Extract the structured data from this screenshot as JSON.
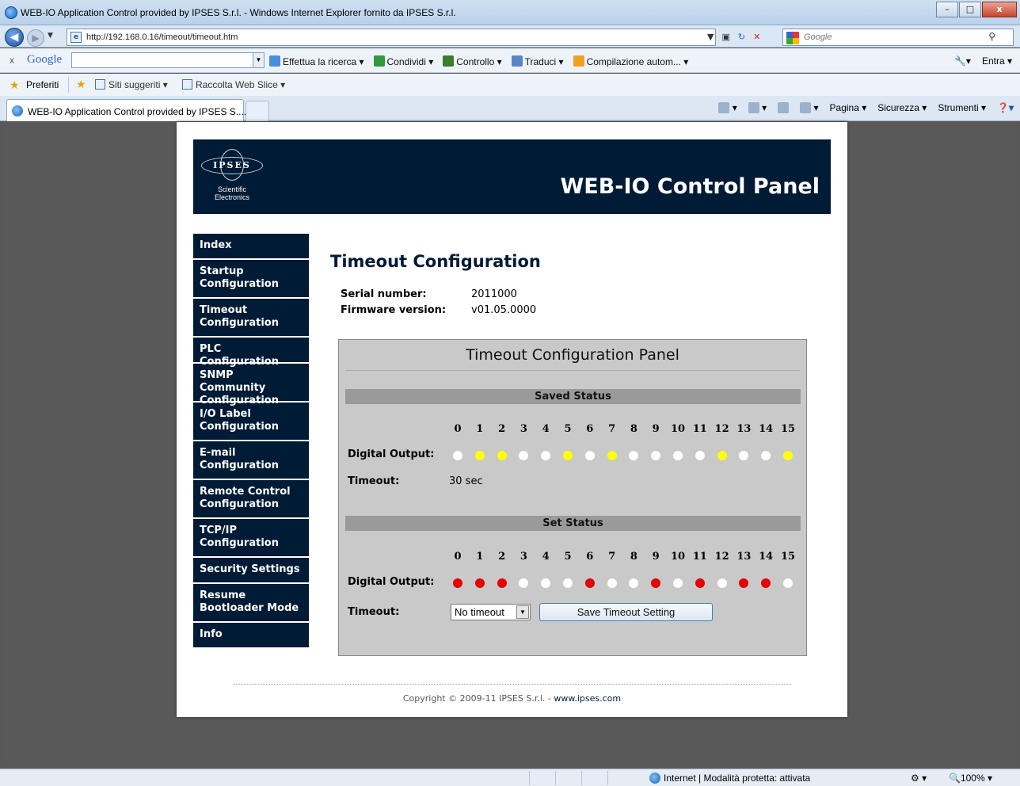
{
  "window": {
    "title": "WEB-IO Application Control provided by IPSES S.r.l. - Windows Internet Explorer fornito da IPSES S.r.l.",
    "minimize": "–",
    "maximize": "□",
    "close": "x"
  },
  "address": {
    "url": "http://192.168.0.16/timeout/timeout.htm",
    "search_placeholder": "Google"
  },
  "google_toolbar": {
    "logo": "Google",
    "items": [
      "Effettua la ricerca ▾",
      "Condividi ▾",
      "Controllo ▾",
      "Traduci ▾",
      "Compilazione autom... ▾"
    ],
    "signin": "Entra ▾"
  },
  "favorites": {
    "label": "Preferiti",
    "items": [
      "Siti suggeriti ▾",
      "Raccolta Web Slice ▾"
    ]
  },
  "tabs": {
    "active": "WEB-IO Application Control provided by IPSES S...."
  },
  "commands": [
    "Pagina ▾",
    "Sicurezza ▾",
    "Strumenti ▾"
  ],
  "banner": {
    "logo_text": "IPSES",
    "logo_sub1": "Scientific",
    "logo_sub2": "Electronics",
    "title": "WEB-IO Control Panel"
  },
  "sidebar": {
    "items": [
      {
        "line1": "Index",
        "line2": ""
      },
      {
        "line1": "Startup",
        "line2": "Configuration"
      },
      {
        "line1": "Timeout",
        "line2": "Configuration"
      },
      {
        "line1": "PLC Configuration",
        "line2": ""
      },
      {
        "line1": "SNMP Community",
        "line2": "Configuration"
      },
      {
        "line1": "I/O Label",
        "line2": "Configuration"
      },
      {
        "line1": "E-mail",
        "line2": "Configuration"
      },
      {
        "line1": "Remote Control",
        "line2": "Configuration"
      },
      {
        "line1": "TCP/IP",
        "line2": "Configuration"
      },
      {
        "line1": "Security Settings",
        "line2": ""
      },
      {
        "line1": "Resume",
        "line2": "Bootloader Mode"
      },
      {
        "line1": "Info",
        "line2": ""
      }
    ]
  },
  "content": {
    "title": "Timeout Configuration",
    "serial_label": "Serial number:",
    "serial_value": "2011000",
    "firmware_label": "Firmware version:",
    "firmware_value": "v01.05.0000"
  },
  "panel": {
    "title": "Timeout Configuration Panel",
    "channels": [
      "0",
      "1",
      "2",
      "3",
      "4",
      "5",
      "6",
      "7",
      "8",
      "9",
      "10",
      "11",
      "12",
      "13",
      "14",
      "15"
    ],
    "saved": {
      "header": "Saved Status",
      "output_label": "Digital Output:",
      "outputs": [
        "off",
        "on",
        "on",
        "off",
        "off",
        "on",
        "off",
        "on",
        "off",
        "off",
        "off",
        "off",
        "on",
        "off",
        "off",
        "on"
      ],
      "timeout_label": "Timeout:",
      "timeout_value": "30 sec"
    },
    "set": {
      "header": "Set Status",
      "output_label": "Digital Output:",
      "outputs": [
        "on",
        "on",
        "on",
        "off",
        "off",
        "off",
        "on",
        "off",
        "off",
        "on",
        "off",
        "on",
        "off",
        "on",
        "on",
        "off"
      ],
      "timeout_label": "Timeout:",
      "timeout_select": "No timeout",
      "save_button": "Save Timeout Setting"
    },
    "colors": {
      "saved_on": "#ffff00",
      "set_on": "#e60000",
      "off": "#ffffff"
    }
  },
  "footer": {
    "text": "Copyright © 2009-11 IPSES S.r.l. - ",
    "link": "www.ipses.com"
  },
  "statusbar": {
    "zone": "Internet | Modalità protetta: attivata",
    "zoom": "100%"
  }
}
